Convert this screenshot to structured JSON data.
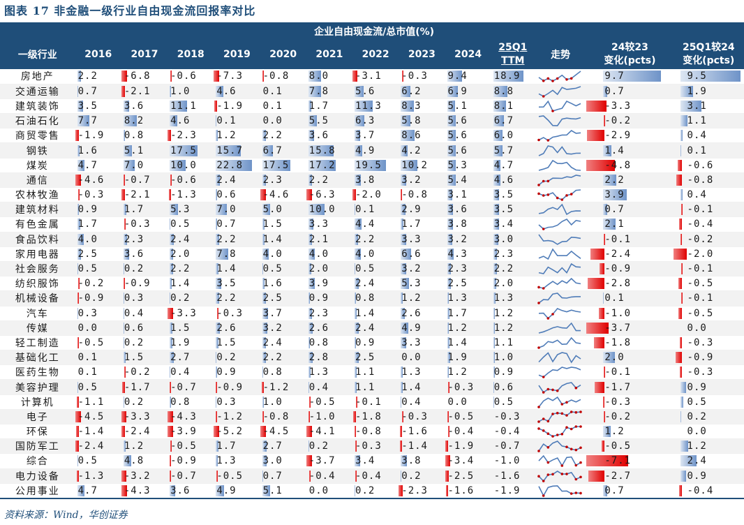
{
  "title": "图表 17   非金融一级行业自由现金流回报率对比",
  "source": "资料来源：Wind，华创证券",
  "header": {
    "group_label": "企业自由现金流/总市值(%)",
    "industry": "一级行业",
    "years": [
      "2016",
      "2017",
      "2018",
      "2019",
      "2020",
      "2021",
      "2022",
      "2023",
      "2024"
    ],
    "ttm_line1": "25Q1",
    "ttm_line2": "TTM",
    "trend": "走势",
    "chg1_line1": "24较23",
    "chg1_line2": "变化(pcts)",
    "chg2_line1": "25Q1较24",
    "chg2_line2": "变化(pcts)"
  },
  "colors": {
    "header_bg": "#1F4E79",
    "pos_bar": "#6E93C8",
    "neg_bar": "#E00000",
    "marker": "#C00000"
  },
  "rows": [
    {
      "name": "房地产",
      "values": [
        "2.2",
        "-6.8",
        "-0.6",
        "-7.3",
        "-0.8",
        "8.0",
        "-3.1",
        "-0.3",
        "9.4"
      ],
      "ttm": "18.9",
      "chg1": "9.7",
      "chg2": "9.5"
    },
    {
      "name": "交通运输",
      "values": [
        "0.7",
        "-2.1",
        "1.0",
        "4.6",
        "0.1",
        "7.8",
        "5.6",
        "6.2",
        "6.9"
      ],
      "ttm": "8.8",
      "chg1": "0.7",
      "chg2": "1.9"
    },
    {
      "name": "建筑装饰",
      "values": [
        "3.5",
        "3.6",
        "11.1",
        "-1.9",
        "0.1",
        "1.7",
        "11.3",
        "8.3",
        "5.1"
      ],
      "ttm": "8.1",
      "chg1": "-3.3",
      "chg2": "3.1"
    },
    {
      "name": "石油石化",
      "values": [
        "7.7",
        "8.2",
        "4.6",
        "0.1",
        "0.0",
        "5.5",
        "6.3",
        "5.8",
        "5.6"
      ],
      "ttm": "6.7",
      "chg1": "-0.2",
      "chg2": "1.1"
    },
    {
      "name": "商贸零售",
      "values": [
        "-1.9",
        "0.8",
        "-2.3",
        "1.2",
        "2.2",
        "3.6",
        "3.7",
        "8.6",
        "5.6"
      ],
      "ttm": "6.0",
      "chg1": "-2.9",
      "chg2": "0.4"
    },
    {
      "name": "钢铁",
      "values": [
        "1.6",
        "5.1",
        "17.5",
        "15.7",
        "6.7",
        "15.8",
        "4.9",
        "4.2",
        "5.6"
      ],
      "ttm": "5.7",
      "chg1": "1.4",
      "chg2": "0.1"
    },
    {
      "name": "煤炭",
      "values": [
        "4.7",
        "7.0",
        "10.0",
        "22.8",
        "17.5",
        "17.2",
        "19.5",
        "10.2",
        "5.3"
      ],
      "ttm": "4.7",
      "chg1": "-4.8",
      "chg2": "-0.6"
    },
    {
      "name": "通信",
      "values": [
        "-4.6",
        "-0.7",
        "-0.6",
        "2.4",
        "2.3",
        "2.2",
        "3.8",
        "3.2",
        "5.4"
      ],
      "ttm": "4.6",
      "chg1": "2.2",
      "chg2": "-0.8"
    },
    {
      "name": "农林牧渔",
      "values": [
        "-0.3",
        "-2.1",
        "-1.3",
        "0.6",
        "-4.6",
        "-6.3",
        "-2.0",
        "-0.8",
        "3.1"
      ],
      "ttm": "3.5",
      "chg1": "3.9",
      "chg2": "0.4"
    },
    {
      "name": "建筑材料",
      "values": [
        "0.9",
        "1.7",
        "5.3",
        "7.0",
        "5.0",
        "10.0",
        "0.1",
        "2.9",
        "3.6"
      ],
      "ttm": "3.5",
      "chg1": "0.7",
      "chg2": "-0.1"
    },
    {
      "name": "有色金属",
      "values": [
        "1.7",
        "-0.3",
        "0.5",
        "0.7",
        "1.5",
        "3.3",
        "4.4",
        "1.7",
        "3.8"
      ],
      "ttm": "3.4",
      "chg1": "2.1",
      "chg2": "-0.4"
    },
    {
      "name": "食品饮料",
      "values": [
        "4.0",
        "2.3",
        "2.4",
        "2.2",
        "1.4",
        "2.1",
        "2.2",
        "3.3",
        "3.2"
      ],
      "ttm": "3.0",
      "chg1": "-0.1",
      "chg2": "-0.2"
    },
    {
      "name": "家用电器",
      "values": [
        "2.5",
        "3.6",
        "2.0",
        "7.8",
        "4.0",
        "4.0",
        "4.0",
        "6.6",
        "4.3"
      ],
      "ttm": "2.3",
      "chg1": "-2.4",
      "chg2": "-2.0"
    },
    {
      "name": "社会服务",
      "values": [
        "0.5",
        "0.2",
        "2.2",
        "1.4",
        "0.5",
        "2.0",
        "0.5",
        "3.2",
        "2.3"
      ],
      "ttm": "2.2",
      "chg1": "-0.9",
      "chg2": "-0.1"
    },
    {
      "name": "纺织服饰",
      "values": [
        "-0.2",
        "-0.9",
        "1.4",
        "3.5",
        "1.6",
        "3.9",
        "2.4",
        "5.3",
        "2.5"
      ],
      "ttm": "2.0",
      "chg1": "-2.8",
      "chg2": "-0.5"
    },
    {
      "name": "机械设备",
      "values": [
        "-0.9",
        "0.3",
        "0.2",
        "2.2",
        "2.5",
        "0.9",
        "0.8",
        "1.2",
        "1.3"
      ],
      "ttm": "1.3",
      "chg1": "0.1",
      "chg2": "-0.1"
    },
    {
      "name": "汽车",
      "values": [
        "0.3",
        "0.4",
        "-3.3",
        "-0.3",
        "3.7",
        "2.3",
        "1.4",
        "2.6",
        "1.7"
      ],
      "ttm": "1.2",
      "chg1": "-1.0",
      "chg2": "-0.5"
    },
    {
      "name": "传媒",
      "values": [
        "0.0",
        "0.6",
        "1.5",
        "2.6",
        "3.2",
        "2.6",
        "2.4",
        "4.9",
        "1.2"
      ],
      "ttm": "1.2",
      "chg1": "-3.7",
      "chg2": "0.0"
    },
    {
      "name": "轻工制造",
      "values": [
        "-0.5",
        "0.2",
        "1.9",
        "1.5",
        "2.4",
        "0.8",
        "0.9",
        "3.3",
        "1.4"
      ],
      "ttm": "1.1",
      "chg1": "-1.8",
      "chg2": "-0.3"
    },
    {
      "name": "基础化工",
      "values": [
        "0.1",
        "1.5",
        "2.7",
        "0.2",
        "2.2",
        "2.8",
        "2.5",
        "0.0",
        "1.9"
      ],
      "ttm": "1.0",
      "chg1": "2.0",
      "chg2": "-0.9"
    },
    {
      "name": "医药生物",
      "values": [
        "0.1",
        "-0.2",
        "0.4",
        "0.9",
        "0.8",
        "1.3",
        "1.1",
        "1.3",
        "1.2"
      ],
      "ttm": "0.9",
      "chg1": "-0.1",
      "chg2": "-0.3"
    },
    {
      "name": "美容护理",
      "values": [
        "0.5",
        "-1.7",
        "-0.7",
        "-0.9",
        "-1.2",
        "0.4",
        "1.1",
        "1.4",
        "-0.3"
      ],
      "ttm": "0.6",
      "chg1": "-1.7",
      "chg2": "0.9"
    },
    {
      "name": "计算机",
      "values": [
        "-1.1",
        "0.2",
        "0.8",
        "0.3",
        "1.0",
        "-0.5",
        "-0.1",
        "0.4",
        "0.0"
      ],
      "ttm": "0.5",
      "chg1": "-0.3",
      "chg2": "0.5"
    },
    {
      "name": "电子",
      "values": [
        "-4.5",
        "-3.3",
        "-4.3",
        "-1.2",
        "-0.8",
        "-1.0",
        "-1.8",
        "-0.3",
        "-0.5"
      ],
      "ttm": "-0.3",
      "chg1": "-0.2",
      "chg2": "0.2"
    },
    {
      "name": "环保",
      "values": [
        "-1.4",
        "-2.4",
        "-3.9",
        "-5.2",
        "-4.5",
        "-4.1",
        "-0.8",
        "-1.6",
        "-0.4"
      ],
      "ttm": "-0.4",
      "chg1": "1.2",
      "chg2": "0.0"
    },
    {
      "name": "国防军工",
      "values": [
        "-2.4",
        "1.2",
        "-0.5",
        "1.7",
        "2.7",
        "0.2",
        "-0.3",
        "-1.4",
        "-1.9"
      ],
      "ttm": "-0.7",
      "chg1": "-0.5",
      "chg2": "1.2"
    },
    {
      "name": "综合",
      "values": [
        "0.5",
        "4.8",
        "-0.9",
        "1.3",
        "3.0",
        "-3.7",
        "3.4",
        "3.8",
        "-3.4"
      ],
      "ttm": "-1.0",
      "chg1": "-7.1",
      "chg2": "2.4"
    },
    {
      "name": "电力设备",
      "values": [
        "-1.3",
        "-3.2",
        "-0.7",
        "-0.5",
        "0.7",
        "-0.4",
        "-0.4",
        "0.2",
        "-2.5"
      ],
      "ttm": "-1.6",
      "chg1": "-2.7",
      "chg2": "0.9"
    },
    {
      "name": "公用事业",
      "values": [
        "4.7",
        "-4.3",
        "3.6",
        "4.9",
        "5.1",
        "0.0",
        "0.2",
        "-2.3",
        "-1.6"
      ],
      "ttm": "-1.9",
      "chg1": "0.7",
      "chg2": "-0.4"
    }
  ]
}
